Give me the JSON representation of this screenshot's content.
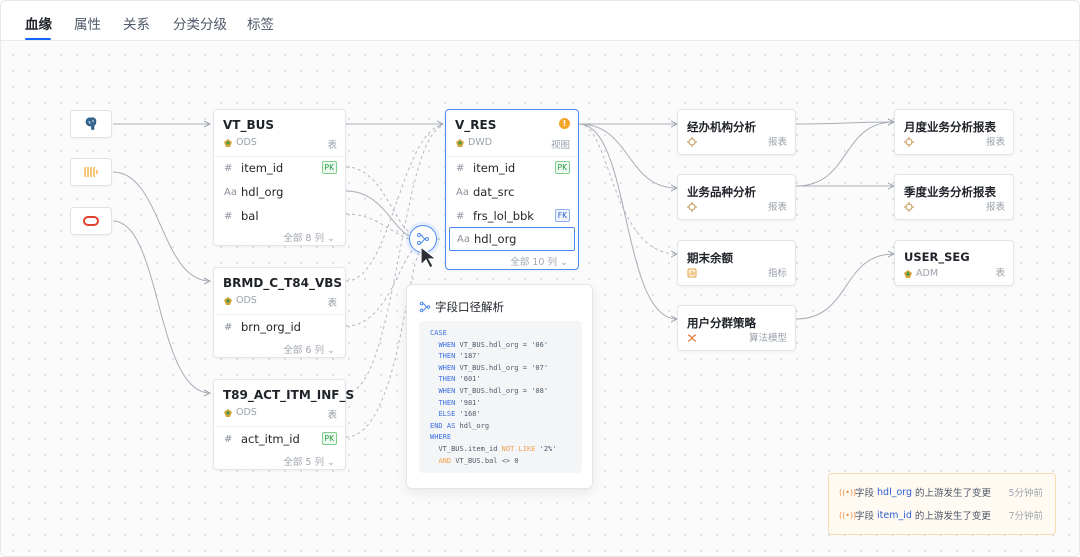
{
  "tabs": [
    {
      "label": "血缘",
      "active": true
    },
    {
      "label": "属性",
      "active": false
    },
    {
      "label": "关系",
      "active": false
    },
    {
      "label": "分类分级",
      "active": false
    },
    {
      "label": "标签",
      "active": false
    }
  ],
  "sources": [
    {
      "icon": "postgresql-elephant-icon"
    },
    {
      "icon": "barcode-stream-icon"
    },
    {
      "icon": "oracle-icon"
    }
  ],
  "tables": {
    "vt_bus": {
      "name": "VT_BUS",
      "layer": "ODS",
      "type": "表",
      "fields": [
        {
          "name": "item_id",
          "kind": "#",
          "badge": "PK"
        },
        {
          "name": "hdl_org",
          "kind": "Aa",
          "badge": ""
        },
        {
          "name": "bal",
          "kind": "#",
          "badge": ""
        }
      ],
      "more": "全部 8 列"
    },
    "brmd": {
      "name": "BRMD_C_T84_VBS",
      "layer": "ODS",
      "type": "表",
      "fields": [
        {
          "name": "brn_org_id",
          "kind": "#",
          "badge": ""
        }
      ],
      "more": "全部 6 列"
    },
    "t89": {
      "name": "T89_ACT_ITM_INF_S",
      "layer": "ODS",
      "type": "表",
      "fields": [
        {
          "name": "act_itm_id",
          "kind": "#",
          "badge": "PK"
        }
      ],
      "more": "全部 5 列"
    },
    "v_res": {
      "name": "V_RES",
      "layer": "DWD",
      "type": "视图",
      "fields": [
        {
          "name": "item_id",
          "kind": "#",
          "badge": "PK"
        },
        {
          "name": "dat_src",
          "kind": "Aa",
          "badge": ""
        },
        {
          "name": "frs_lol_bbk",
          "kind": "#",
          "badge": "FK"
        },
        {
          "name": "hdl_org",
          "kind": "Aa",
          "badge": ""
        }
      ],
      "more": "全部 10 列"
    }
  },
  "targets": {
    "t1": {
      "name": "经办机构分析",
      "type": "报表",
      "icon": "report-icon"
    },
    "t2": {
      "name": "业务品种分析",
      "type": "报表",
      "icon": "report-icon"
    },
    "t3": {
      "name": "期末余额",
      "type": "指标",
      "icon": "metric-icon"
    },
    "t4": {
      "name": "用户分群策略",
      "type": "算法模型",
      "icon": "algorithm-icon"
    },
    "t5": {
      "name": "月度业务分析报表",
      "type": "报表",
      "icon": "report-icon"
    },
    "t6": {
      "name": "季度业务分析报表",
      "type": "报表",
      "icon": "report-icon"
    },
    "t7": {
      "name": "USER_SEG",
      "type": "表",
      "layer": "ADM",
      "icon": "table-icon"
    }
  },
  "popover": {
    "title": "字段口径解析",
    "code": [
      [
        "CASE"
      ],
      [
        "  WHEN VT_BUS.hdl_org = '06'"
      ],
      [
        "  THEN '187'"
      ],
      [
        "  WHEN VT_BUS.hdl_org = '07'"
      ],
      [
        "  THEN '601'"
      ],
      [
        "  WHEN VT_BUS.hdl_org = '08'"
      ],
      [
        "  THEN '981'"
      ],
      [
        "  ELSE '168'"
      ],
      [
        "END AS hdl_org"
      ],
      [
        "WHERE"
      ],
      [
        "  VT_BUS.item_id NOT LIKE '2%'"
      ],
      [
        "  AND VT_BUS.bal <> 0"
      ]
    ]
  },
  "notices": [
    {
      "prefix": "字段",
      "field": "hdl_org",
      "suffix": "的上游发生了变更",
      "time": "5分钟前"
    },
    {
      "prefix": "字段",
      "field": "item_id",
      "suffix": "的上游发生了变更",
      "time": "7分钟前"
    }
  ],
  "colors": {
    "accent": "#1664ff",
    "selected_border": "#4d8bf0",
    "warning": "#f4a62a",
    "pk": "#1f9a3f",
    "fk": "#2a5fd1"
  }
}
